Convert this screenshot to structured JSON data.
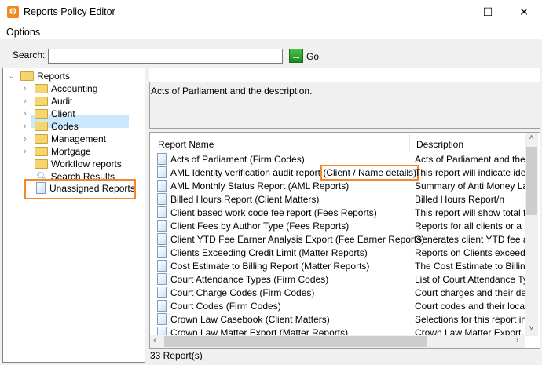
{
  "window": {
    "title": "Reports Policy Editor",
    "minimize": "—",
    "maximize": "☐",
    "close": "✕"
  },
  "menu": {
    "options": "Options"
  },
  "search": {
    "label": "Search:",
    "value": "",
    "go": "Go"
  },
  "tree": {
    "root": "Reports",
    "children": [
      "Accounting",
      "Audit",
      "Client",
      "Codes",
      "Management",
      "Mortgage",
      "Workflow reports"
    ],
    "search_results": "Search Results",
    "unassigned": "Unassigned Reports"
  },
  "description_text": "Acts of Parliament and the description.",
  "list": {
    "columns": [
      "Report Name",
      "Description"
    ],
    "rows": [
      {
        "name": "Acts of Parliament (Firm Codes)",
        "desc": "Acts of Parliament and the de"
      },
      {
        "name": "AML Identity verification audit report",
        "category": "(Client / Name details)",
        "desc": "This report will indicate identit"
      },
      {
        "name": "AML Monthly Status Report (AML Reports)",
        "desc": "Summary of Anti Money Laun"
      },
      {
        "name": "Billed Hours Report (Client Matters)",
        "desc": "Billed Hours Report/n"
      },
      {
        "name": "Client based work code fee report (Fees Reports)",
        "desc": "This report will show total fee"
      },
      {
        "name": "Client Fees by Author Type (Fees Reports)",
        "desc": "Reports for all clients or a sele"
      },
      {
        "name": "Client YTD Fee Earner Analysis Export (Fee Earner Reports)",
        "desc": "Generates client YTD fee amo"
      },
      {
        "name": "Clients Exceeding Credit Limit (Matter Reports)",
        "desc": "Reports on Clients exceeding"
      },
      {
        "name": "Cost Estimate to Billing Report (Matter Reports)",
        "desc": "The Cost Estimate to Billing Re"
      },
      {
        "name": "Court Attendance Types (Firm Codes)",
        "desc": "List of Court Attendance Type"
      },
      {
        "name": "Court Charge Codes (Firm Codes)",
        "desc": "Court charges and their descr"
      },
      {
        "name": "Court Codes (Firm Codes)",
        "desc": "Court codes and their locatior"
      },
      {
        "name": "Crown Law Casebook (Client Matters)",
        "desc": "Selections for this report inclu"
      },
      {
        "name": "Crown Law Matter Export (Matter Reports)",
        "desc": "Crown Law Matter Export. Sp"
      }
    ]
  },
  "status": "33 Report(s)",
  "colors": {
    "accent": "#f5872a",
    "selection": "#cce8ff"
  }
}
